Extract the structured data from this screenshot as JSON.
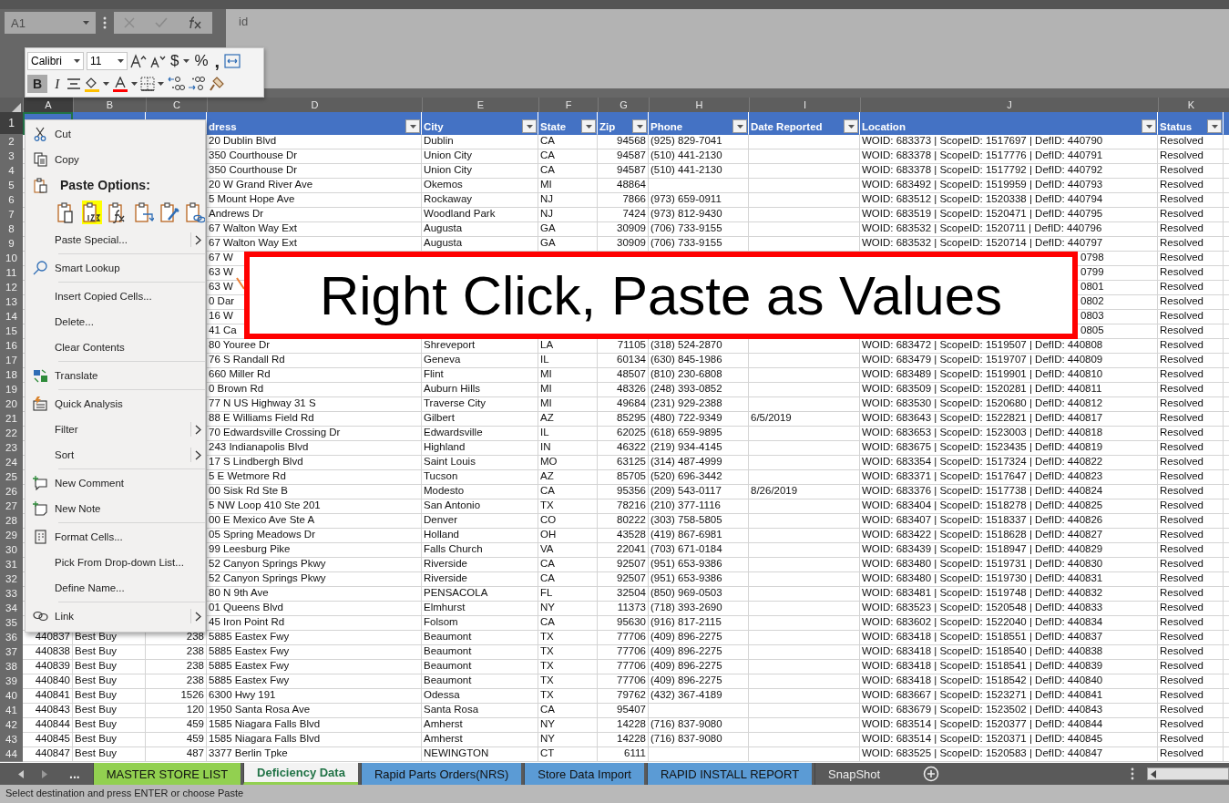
{
  "formula_bar": {
    "name_box": "A1",
    "formula": "id"
  },
  "mini_toolbar": {
    "font": "Calibri",
    "size": "11",
    "currency": "$",
    "percent": "%",
    "comma": ",",
    "bold": {
      "label": "B",
      "selected": true
    },
    "italic": {
      "label": "I",
      "selected": false
    }
  },
  "column_letters": [
    "A",
    "B",
    "C",
    "D",
    "E",
    "F",
    "G",
    "H",
    "I",
    "J",
    "K"
  ],
  "header_row": {
    "number": "1",
    "cells": [
      {
        "selected": true
      },
      {
        "selected": false
      },
      {
        "selected": false
      },
      {
        "label": "dress",
        "selected": false
      },
      {
        "label": "City",
        "selected": false
      },
      {
        "label": "State",
        "selected": false
      },
      {
        "label": "Zip",
        "selected": false
      },
      {
        "label": "Phone",
        "selected": false
      },
      {
        "label": "Date Reported",
        "selected": false
      },
      {
        "label": "Location",
        "selected": false
      },
      {
        "label": "Status",
        "selected": false
      }
    ]
  },
  "rows": [
    {
      "number": "2",
      "cells": [
        null,
        null,
        null,
        "20 Dublin Blvd",
        "Dublin",
        "CA",
        "94568",
        "(925) 829-7041",
        null,
        "WOID: 683373 | ScopeID: 1517697 | DefID: 440790",
        "Resolved"
      ]
    },
    {
      "number": "3",
      "cells": [
        null,
        null,
        null,
        "350 Courthouse Dr",
        "Union City",
        "CA",
        "94587",
        "(510) 441-2130",
        null,
        "WOID: 683378 | ScopeID: 1517776 | DefID: 440791",
        "Resolved"
      ]
    },
    {
      "number": "4",
      "cells": [
        null,
        null,
        null,
        "350 Courthouse Dr",
        "Union City",
        "CA",
        "94587",
        "(510) 441-2130",
        null,
        "WOID: 683378 | ScopeID: 1517792 | DefID: 440792",
        "Resolved"
      ]
    },
    {
      "number": "5",
      "cells": [
        null,
        null,
        null,
        "20 W Grand River Ave",
        "Okemos",
        "MI",
        "48864",
        null,
        null,
        "WOID: 683492 | ScopeID: 1519959 | DefID: 440793",
        "Resolved"
      ]
    },
    {
      "number": "6",
      "cells": [
        null,
        null,
        null,
        "5 Mount Hope Ave",
        "Rockaway",
        "NJ",
        "7866",
        "(973) 659-0911",
        null,
        "WOID: 683512 | ScopeID: 1520338 | DefID: 440794",
        "Resolved"
      ]
    },
    {
      "number": "7",
      "cells": [
        null,
        null,
        null,
        "Andrews Dr",
        "Woodland Park",
        "NJ",
        "7424",
        "(973) 812-9430",
        null,
        "WOID: 683519 | ScopeID: 1520471 | DefID: 440795",
        "Resolved"
      ]
    },
    {
      "number": "8",
      "cells": [
        null,
        null,
        null,
        "67 Walton Way Ext",
        "Augusta",
        "GA",
        "30909",
        "(706) 733-9155",
        null,
        "WOID: 683532 | ScopeID: 1520711 | DefID: 440796",
        "Resolved"
      ]
    },
    {
      "number": "9",
      "cells": [
        null,
        null,
        null,
        "67 Walton Way Ext",
        "Augusta",
        "GA",
        "30909",
        "(706) 733-9155",
        null,
        "WOID: 683532 | ScopeID: 1520714 | DefID: 440797",
        "Resolved"
      ]
    },
    {
      "number": "10",
      "cells": [
        null,
        null,
        null,
        "67 W",
        null,
        null,
        null,
        null,
        null,
        "0798",
        "Resolved"
      ]
    },
    {
      "number": "11",
      "cells": [
        null,
        null,
        null,
        "63 W",
        null,
        null,
        null,
        null,
        null,
        "0799",
        "Resolved"
      ]
    },
    {
      "number": "12",
      "cells": [
        null,
        null,
        null,
        "63 W",
        null,
        null,
        null,
        null,
        null,
        "0801",
        "Resolved"
      ]
    },
    {
      "number": "13",
      "cells": [
        null,
        null,
        null,
        "0 Dar",
        null,
        null,
        null,
        null,
        null,
        "0802",
        "Resolved"
      ]
    },
    {
      "number": "14",
      "cells": [
        null,
        null,
        null,
        "16 W",
        null,
        null,
        null,
        null,
        null,
        "0803",
        "Resolved"
      ]
    },
    {
      "number": "15",
      "cells": [
        null,
        null,
        null,
        "41 Ca",
        null,
        null,
        null,
        null,
        null,
        "0805",
        "Resolved"
      ]
    },
    {
      "number": "16",
      "cells": [
        null,
        null,
        null,
        "80 Youree Dr",
        "Shreveport",
        "LA",
        "71105",
        "(318) 524-2870",
        null,
        "WOID: 683472 | ScopeID: 1519507 | DefID: 440808",
        "Resolved"
      ]
    },
    {
      "number": "17",
      "cells": [
        null,
        null,
        null,
        "76 S Randall Rd",
        "Geneva",
        "IL",
        "60134",
        "(630) 845-1986",
        null,
        "WOID: 683479 | ScopeID: 1519707 | DefID: 440809",
        "Resolved"
      ]
    },
    {
      "number": "18",
      "cells": [
        null,
        null,
        null,
        "660 Miller Rd",
        "Flint",
        "MI",
        "48507",
        "(810) 230-6808",
        null,
        "WOID: 683489 | ScopeID: 1519901 | DefID: 440810",
        "Resolved"
      ]
    },
    {
      "number": "19",
      "cells": [
        null,
        null,
        null,
        "0 Brown Rd",
        "Auburn Hills",
        "MI",
        "48326",
        "(248) 393-0852",
        null,
        "WOID: 683509 | ScopeID: 1520281 | DefID: 440811",
        "Resolved"
      ]
    },
    {
      "number": "20",
      "cells": [
        null,
        null,
        null,
        "77 N US Highway 31 S",
        "Traverse City",
        "MI",
        "49684",
        "(231) 929-2388",
        null,
        "WOID: 683530 | ScopeID: 1520680 | DefID: 440812",
        "Resolved"
      ]
    },
    {
      "number": "21",
      "cells": [
        null,
        null,
        null,
        "88 E Williams Field Rd",
        "Gilbert",
        "AZ",
        "85295",
        "(480) 722-9349",
        "6/5/2019",
        "WOID: 683643 | ScopeID: 1522821 | DefID: 440817",
        "Resolved"
      ]
    },
    {
      "number": "22",
      "cells": [
        null,
        null,
        null,
        "70 Edwardsville Crossing Dr",
        "Edwardsville",
        "IL",
        "62025",
        "(618) 659-9895",
        null,
        "WOID: 683653 | ScopeID: 1523003 | DefID: 440818",
        "Resolved"
      ]
    },
    {
      "number": "23",
      "cells": [
        null,
        null,
        null,
        "243 Indianapolis Blvd",
        "Highland",
        "IN",
        "46322",
        "(219) 934-4145",
        null,
        "WOID: 683675 | ScopeID: 1523435 | DefID: 440819",
        "Resolved"
      ]
    },
    {
      "number": "24",
      "cells": [
        null,
        null,
        null,
        "17 S Lindbergh Blvd",
        "Saint Louis",
        "MO",
        "63125",
        "(314) 487-4999",
        null,
        "WOID: 683354 | ScopeID: 1517324 | DefID: 440822",
        "Resolved"
      ]
    },
    {
      "number": "25",
      "cells": [
        null,
        null,
        null,
        "5 E Wetmore Rd",
        "Tucson",
        "AZ",
        "85705",
        "(520) 696-3442",
        null,
        "WOID: 683371 | ScopeID: 1517647 | DefID: 440823",
        "Resolved"
      ]
    },
    {
      "number": "26",
      "cells": [
        null,
        null,
        null,
        "00 Sisk Rd Ste B",
        "Modesto",
        "CA",
        "95356",
        "(209) 543-0117",
        "8/26/2019",
        "WOID: 683376 | ScopeID: 1517738 | DefID: 440824",
        "Resolved"
      ]
    },
    {
      "number": "27",
      "cells": [
        null,
        null,
        null,
        "5 NW Loop 410 Ste 201",
        "San Antonio",
        "TX",
        "78216",
        "(210) 377-1116",
        null,
        "WOID: 683404 | ScopeID: 1518278 | DefID: 440825",
        "Resolved"
      ]
    },
    {
      "number": "28",
      "cells": [
        null,
        null,
        null,
        "00 E Mexico Ave Ste A",
        "Denver",
        "CO",
        "80222",
        "(303) 758-5805",
        null,
        "WOID: 683407 | ScopeID: 1518337 | DefID: 440826",
        "Resolved"
      ]
    },
    {
      "number": "29",
      "cells": [
        null,
        null,
        null,
        "05 Spring Meadows Dr",
        "Holland",
        "OH",
        "43528",
        "(419) 867-6981",
        null,
        "WOID: 683422 | ScopeID: 1518628 | DefID: 440827",
        "Resolved"
      ]
    },
    {
      "number": "30",
      "cells": [
        null,
        null,
        null,
        "99 Leesburg Pike",
        "Falls Church",
        "VA",
        "22041",
        "(703) 671-0184",
        null,
        "WOID: 683439 | ScopeID: 1518947 | DefID: 440829",
        "Resolved"
      ]
    },
    {
      "number": "31",
      "cells": [
        null,
        null,
        null,
        "52 Canyon Springs Pkwy",
        "Riverside",
        "CA",
        "92507",
        "(951) 653-9386",
        null,
        "WOID: 683480 | ScopeID: 1519731 | DefID: 440830",
        "Resolved"
      ]
    },
    {
      "number": "32",
      "cells": [
        null,
        null,
        null,
        "52 Canyon Springs Pkwy",
        "Riverside",
        "CA",
        "92507",
        "(951) 653-9386",
        null,
        "WOID: 683480 | ScopeID: 1519730 | DefID: 440831",
        "Resolved"
      ]
    },
    {
      "number": "33",
      "cells": [
        null,
        null,
        null,
        "80 N 9th Ave",
        "PENSACOLA",
        "FL",
        "32504",
        "(850) 969-0503",
        null,
        "WOID: 683481 | ScopeID: 1519748 | DefID: 440832",
        "Resolved"
      ]
    },
    {
      "number": "34",
      "cells": [
        null,
        null,
        null,
        "01 Queens Blvd",
        "Elmhurst",
        "NY",
        "11373",
        "(718) 393-2690",
        null,
        "WOID: 683523 | ScopeID: 1520548 | DefID: 440833",
        "Resolved"
      ]
    },
    {
      "number": "35",
      "cells": [
        null,
        null,
        null,
        "45 Iron Point Rd",
        "Folsom",
        "CA",
        "95630",
        "(916) 817-2115",
        null,
        "WOID: 683602 | ScopeID: 1522040 | DefID: 440834",
        "Resolved"
      ]
    },
    {
      "number": "36",
      "cells": [
        "440837",
        "Best Buy",
        "238",
        "5885 Eastex Fwy",
        "Beaumont",
        "TX",
        "77706",
        "(409) 896-2275",
        null,
        "WOID: 683418 | ScopeID: 1518551 | DefID: 440837",
        "Resolved"
      ]
    },
    {
      "number": "37",
      "cells": [
        "440838",
        "Best Buy",
        "238",
        "5885 Eastex Fwy",
        "Beaumont",
        "TX",
        "77706",
        "(409) 896-2275",
        null,
        "WOID: 683418 | ScopeID: 1518540 | DefID: 440838",
        "Resolved"
      ]
    },
    {
      "number": "38",
      "cells": [
        "440839",
        "Best Buy",
        "238",
        "5885 Eastex Fwy",
        "Beaumont",
        "TX",
        "77706",
        "(409) 896-2275",
        null,
        "WOID: 683418 | ScopeID: 1518541 | DefID: 440839",
        "Resolved"
      ]
    },
    {
      "number": "39",
      "cells": [
        "440840",
        "Best Buy",
        "238",
        "5885 Eastex Fwy",
        "Beaumont",
        "TX",
        "77706",
        "(409) 896-2275",
        null,
        "WOID: 683418 | ScopeID: 1518542 | DefID: 440840",
        "Resolved"
      ]
    },
    {
      "number": "40",
      "cells": [
        "440841",
        "Best Buy",
        "1526",
        "6300 Hwy 191",
        "Odessa",
        "TX",
        "79762",
        "(432) 367-4189",
        null,
        "WOID: 683667 | ScopeID: 1523271 | DefID: 440841",
        "Resolved"
      ]
    },
    {
      "number": "41",
      "cells": [
        "440843",
        "Best Buy",
        "120",
        "1950 Santa Rosa Ave",
        "Santa Rosa",
        "CA",
        "95407",
        null,
        null,
        "WOID: 683679 | ScopeID: 1523502 | DefID: 440843",
        "Resolved"
      ]
    },
    {
      "number": "42",
      "cells": [
        "440844",
        "Best Buy",
        "459",
        "1585 Niagara Falls Blvd",
        "Amherst",
        "NY",
        "14228",
        "(716) 837-9080",
        null,
        "WOID: 683514 | ScopeID: 1520377 | DefID: 440844",
        "Resolved"
      ]
    },
    {
      "number": "43",
      "cells": [
        "440845",
        "Best Buy",
        "459",
        "1585 Niagara Falls Blvd",
        "Amherst",
        "NY",
        "14228",
        "(716) 837-9080",
        null,
        "WOID: 683514 | ScopeID: 1520371 | DefID: 440845",
        "Resolved"
      ]
    },
    {
      "number": "44",
      "cells": [
        "440847",
        "Best Buy",
        "487",
        "3377 Berlin Tpke",
        "NEWINGTON",
        "CT",
        "6111",
        null,
        null,
        "WOID: 683525 | ScopeID: 1520583 | DefID: 440847",
        "Resolved"
      ]
    }
  ],
  "context_menu": {
    "groups": [
      {
        "items": [
          {
            "kind": "command",
            "label": "Cut",
            "submenu": false
          },
          {
            "kind": "command",
            "label": "Copy",
            "submenu": false
          },
          {
            "kind": "header",
            "label": "Paste Options:"
          },
          {
            "kind": "paste-options",
            "options": [
              {
                "selected": false
              },
              {
                "selected": true
              },
              {
                "selected": false
              },
              {
                "selected": false
              },
              {
                "selected": false
              },
              {
                "selected": false
              }
            ]
          },
          {
            "kind": "command",
            "label": "Paste Special...",
            "submenu": true
          }
        ]
      },
      {
        "items": [
          {
            "kind": "command",
            "label": "Smart Lookup",
            "submenu": false
          }
        ]
      },
      {
        "items": [
          {
            "kind": "command",
            "label": "Insert Copied Cells...",
            "submenu": false
          },
          {
            "kind": "command",
            "label": "Delete...",
            "submenu": false
          },
          {
            "kind": "command",
            "label": "Clear Contents",
            "submenu": false
          }
        ]
      },
      {
        "items": [
          {
            "kind": "command",
            "label": "Translate",
            "submenu": false
          }
        ]
      },
      {
        "items": [
          {
            "kind": "command",
            "label": "Quick Analysis",
            "submenu": false
          },
          {
            "kind": "command",
            "label": "Filter",
            "submenu": true
          },
          {
            "kind": "command",
            "label": "Sort",
            "submenu": true
          }
        ]
      },
      {
        "items": [
          {
            "kind": "command",
            "label": "New Comment",
            "submenu": false
          },
          {
            "kind": "command",
            "label": "New Note",
            "submenu": false
          }
        ]
      },
      {
        "items": [
          {
            "kind": "command",
            "label": "Format Cells...",
            "submenu": false
          },
          {
            "kind": "command",
            "label": "Pick From Drop-down List...",
            "submenu": false
          },
          {
            "kind": "command",
            "label": "Define Name...",
            "submenu": false
          }
        ]
      },
      {
        "items": [
          {
            "kind": "command",
            "label": "Link",
            "submenu": true
          }
        ]
      }
    ]
  },
  "callout": {
    "text": "Right Click, Paste as Values"
  },
  "sheet_tabs": {
    "more": "...",
    "tabs": [
      {
        "label": "MASTER STORE LIST",
        "color": "#92d050",
        "selected": false
      },
      {
        "label": "Deficiency Data",
        "color": "#92d050",
        "selected": true
      },
      {
        "label": "Rapid Parts Orders(NRS)",
        "color": "#5b9bd5",
        "selected": false
      },
      {
        "label": "Store Data Import",
        "color": "#5b9bd5",
        "selected": false
      },
      {
        "label": "RAPID INSTALL REPORT",
        "color": "#5b9bd5",
        "selected": false
      },
      {
        "label": "SnapShot",
        "selected": false
      }
    ]
  },
  "status_bar": {
    "text": "Select destination and press ENTER or choose Paste"
  }
}
